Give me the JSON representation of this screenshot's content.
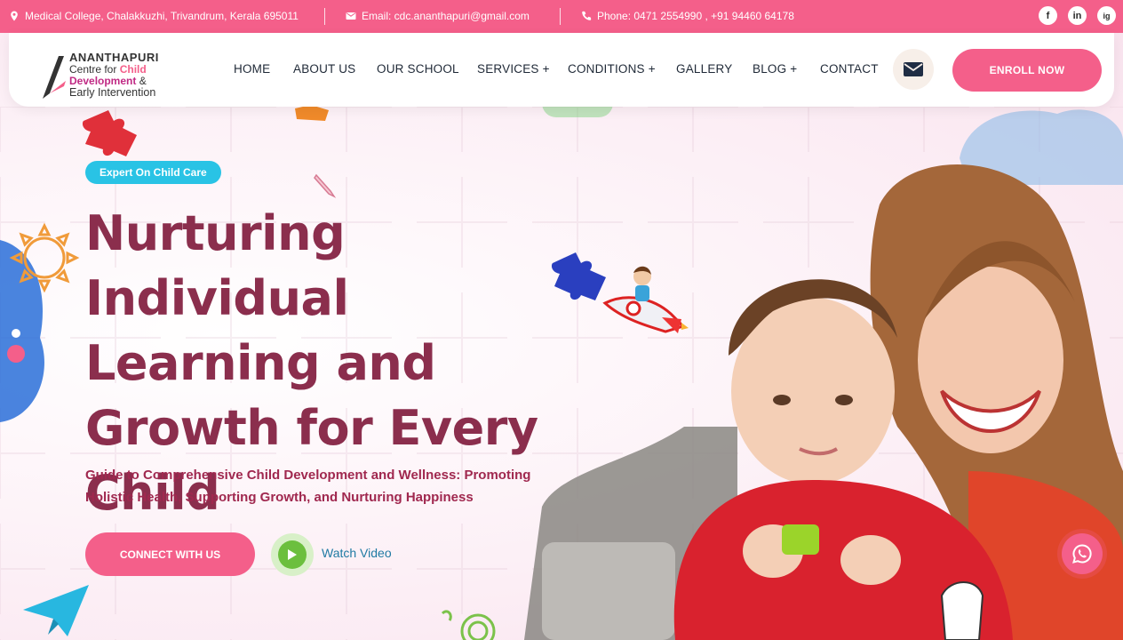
{
  "topbar": {
    "address": "Medical College, Chalakkuzhi, Trivandrum, Kerala 695011",
    "email": "Email: cdc.ananthapuri@gmail.com",
    "phone": "Phone: 0471 2554990 , +91 94460 64178",
    "social": [
      "f",
      "in",
      "ig"
    ]
  },
  "logo": {
    "line1": "ANANTHAPURI",
    "line2a": "Centre for ",
    "line2b": "Child",
    "line3a": "Development",
    "line3b": " &",
    "line4": "Early Intervention"
  },
  "nav": {
    "items": [
      "HOME",
      "ABOUT US",
      "OUR SCHOOL",
      "SERVICES +",
      "CONDITIONS +",
      "GALLERY",
      "BLOG +",
      "CONTACT"
    ],
    "enroll_label": "ENROLL NOW"
  },
  "hero": {
    "badge": "Expert On Child Care",
    "headline_lines": [
      "Nurturing Individual",
      "Learning and",
      "Growth for Every",
      "Child"
    ],
    "subtext": "Guide to Comprehensive Child Development and Wellness: Promoting Holistic Health, Supporting Growth, and Nurturing Happiness",
    "connect_label": "CONNECT WITH US",
    "watch_label": "Watch Video"
  },
  "colors": {
    "brand_pink": "#f45f8a",
    "headline": "#8b2e4d",
    "badge_cyan": "#29c3e5",
    "play_green": "#6cbf3e"
  },
  "icons": [
    "location-icon",
    "email-icon",
    "phone-icon",
    "facebook-icon",
    "linkedin-icon",
    "instagram-icon",
    "envelope-icon",
    "play-icon",
    "whatsapp-icon"
  ]
}
